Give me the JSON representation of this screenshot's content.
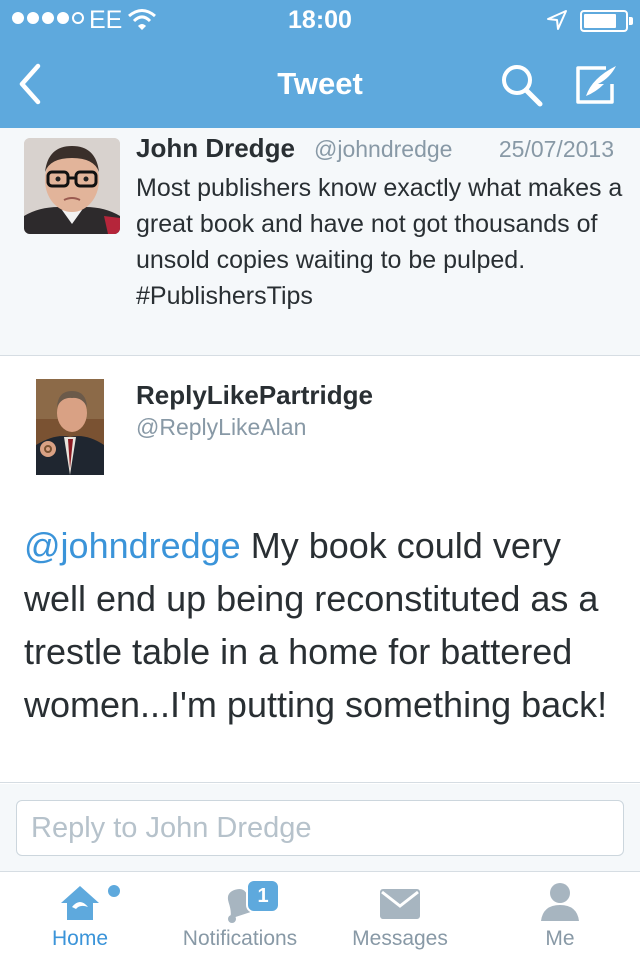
{
  "status_bar": {
    "carrier": "EE",
    "time": "18:00",
    "signal_bars_filled": 4,
    "signal_bars_total": 5,
    "battery_level": 0.75
  },
  "nav": {
    "title": "Tweet",
    "icons": [
      "back-chevron-icon",
      "search-icon",
      "compose-tweet-icon"
    ]
  },
  "parent_tweet": {
    "name": "John Dredge",
    "handle": "@johndredge",
    "date": "25/07/2013",
    "text": "Most publishers know exactly what makes a great book and have not got thousands of unsold copies waiting to be pulped. #PublishersTips"
  },
  "main_tweet": {
    "name": "ReplyLikePartridge",
    "handle": "@ReplyLikeAlan",
    "mention": "@johndredge",
    "text": " My book could very well end up being reconstituted as a trestle table in a home for battered women...I'm putting something back!"
  },
  "reply": {
    "placeholder": "Reply to John Dredge"
  },
  "tabs": [
    {
      "label": "Home",
      "icon": "home-icon",
      "active": true
    },
    {
      "label": "Notifications",
      "icon": "bell-icon",
      "badge": "1"
    },
    {
      "label": "Messages",
      "icon": "envelope-icon"
    },
    {
      "label": "Me",
      "icon": "person-icon"
    }
  ],
  "colors": {
    "brand_blue": "#5ea9dd",
    "link_blue": "#3b94d9",
    "secondary_text": "#8899a6"
  }
}
